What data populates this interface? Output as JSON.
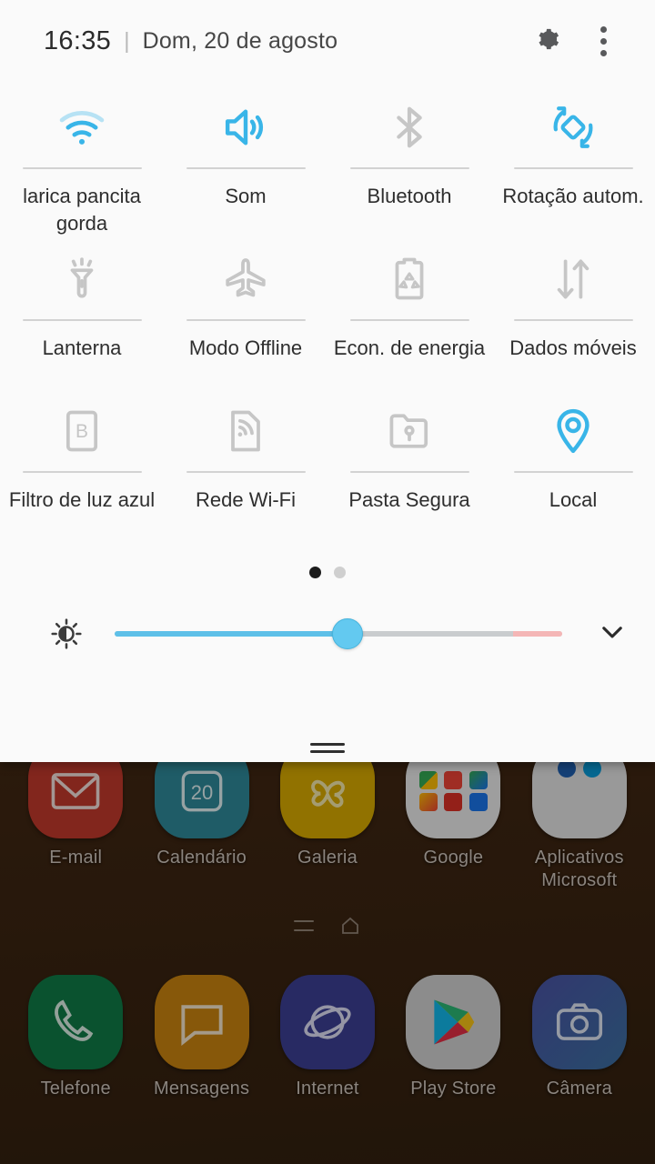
{
  "panel": {
    "header": {
      "time": "16:35",
      "separator": "|",
      "date": "Dom, 20 de agosto",
      "settings_icon": "gear-icon",
      "overflow_icon": "more-vertical-icon"
    },
    "tiles": [
      {
        "label": "larica pancita gorda",
        "icon": "wifi-icon",
        "state": "on"
      },
      {
        "label": "Som",
        "icon": "sound-icon",
        "state": "on"
      },
      {
        "label": "Bluetooth",
        "icon": "bluetooth-icon",
        "state": "off"
      },
      {
        "label": "Rotação autom.",
        "icon": "auto-rotate-icon",
        "state": "on"
      },
      {
        "label": "Lanterna",
        "icon": "flashlight-icon",
        "state": "off"
      },
      {
        "label": "Modo Offline",
        "icon": "airplane-icon",
        "state": "off"
      },
      {
        "label": "Econ. de energia",
        "icon": "battery-saver-icon",
        "state": "off"
      },
      {
        "label": "Dados móveis",
        "icon": "mobile-data-icon",
        "state": "off"
      },
      {
        "label": "Filtro de luz azul",
        "icon": "blue-light-filter-icon",
        "state": "off"
      },
      {
        "label": "Rede Wi-Fi",
        "icon": "wifi-sharing-icon",
        "state": "off"
      },
      {
        "label": "Pasta Segura",
        "icon": "secure-folder-icon",
        "state": "off"
      },
      {
        "label": "Local",
        "icon": "location-pin-icon",
        "state": "on"
      }
    ],
    "pages": {
      "count": 2,
      "active": 1
    },
    "brightness": {
      "icon": "brightness-auto-icon",
      "value_percent": 52,
      "warn_zone_percent": 11,
      "expand_icon": "chevron-down-icon"
    },
    "drag_handle": "panel-drag-handle"
  },
  "home": {
    "apps_top": [
      {
        "label": "E-mail",
        "icon": "email-icon",
        "color": "#c0392b"
      },
      {
        "label": "Calendário",
        "icon": "calendar-icon",
        "color": "#2e8898",
        "badge": "20"
      },
      {
        "label": "Galeria",
        "icon": "gallery-icon",
        "color": "#d6a900"
      },
      {
        "label": "Google",
        "icon": "google-folder-icon",
        "color": "#e8e8e8"
      },
      {
        "label": "Aplicativos Microsoft",
        "icon": "microsoft-folder-icon",
        "color": "#e0e0e0"
      }
    ],
    "apps_dock": [
      {
        "label": "Telefone",
        "icon": "phone-icon",
        "color": "#0f7a46"
      },
      {
        "label": "Mensagens",
        "icon": "messages-icon",
        "color": "#c8820f"
      },
      {
        "label": "Internet",
        "icon": "internet-icon",
        "color": "#3b3f93"
      },
      {
        "label": "Play Store",
        "icon": "play-store-icon",
        "color": "#cfcfcf"
      },
      {
        "label": "Câmera",
        "icon": "camera-icon",
        "color": "#4a52a3"
      }
    ],
    "indicators": {
      "apps_icon": "app-list-icon",
      "home_icon": "home-icon"
    }
  },
  "colors": {
    "accent_blue": "#39b5e8",
    "inactive_gray": "#c6c6c6",
    "panel_bg": "#fafafa",
    "text_primary": "#2e2e2e"
  }
}
